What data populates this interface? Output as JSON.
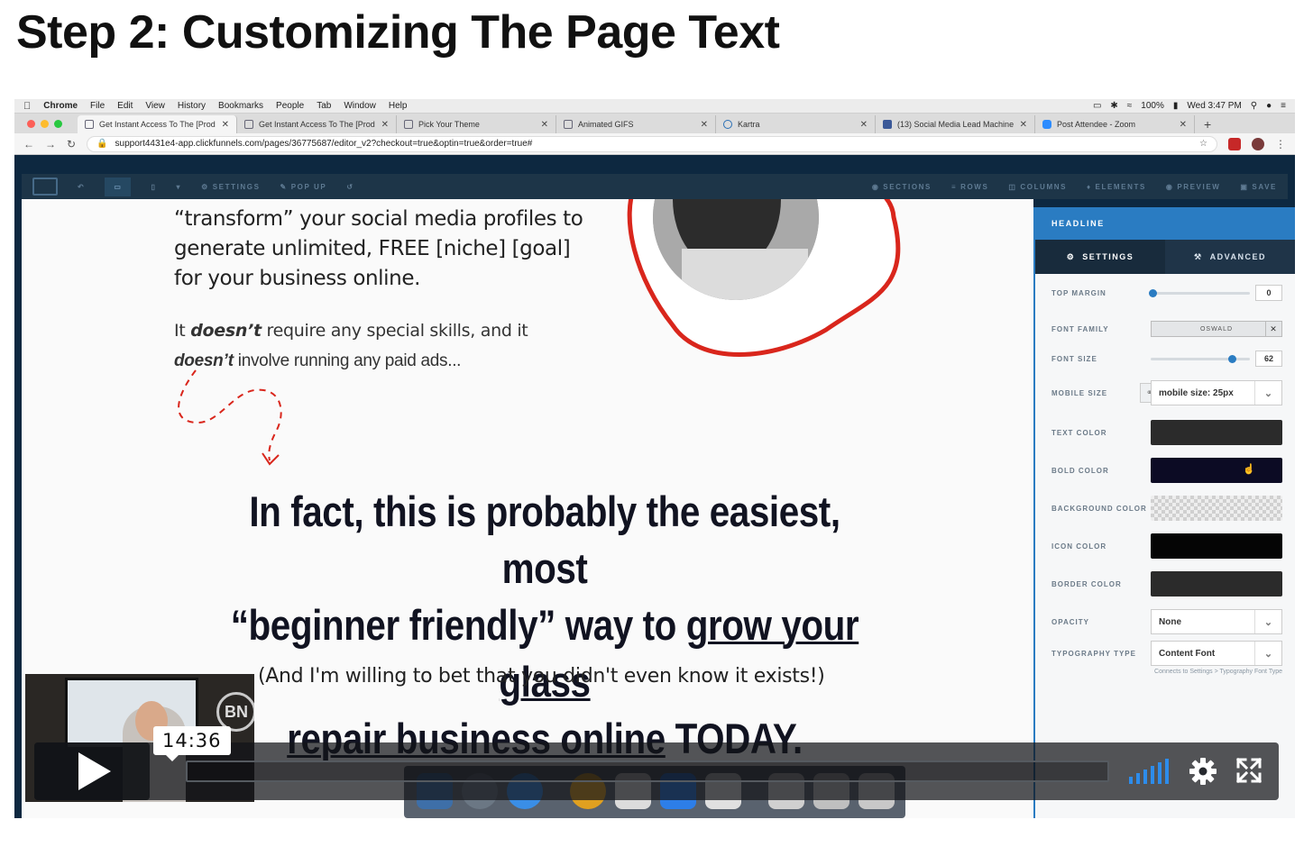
{
  "page": {
    "heading": "Step 2: Customizing The Page Text"
  },
  "mac_menubar": {
    "app": "Chrome",
    "items": [
      "File",
      "Edit",
      "View",
      "History",
      "Bookmarks",
      "People",
      "Tab",
      "Window",
      "Help"
    ],
    "battery": "100%",
    "clock": "Wed 3:47 PM"
  },
  "browser": {
    "tabs": [
      {
        "title": "Get Instant Access To The [Prod"
      },
      {
        "title": "Get Instant Access To The [Prod"
      },
      {
        "title": "Pick Your Theme"
      },
      {
        "title": "Animated GIFS"
      },
      {
        "title": "Kartra"
      },
      {
        "title": "(13) Social Media Lead Machine"
      },
      {
        "title": "Post Attendee - Zoom"
      }
    ],
    "url": "support4431e4-app.clickfunnels.com/pages/36775687/editor_v2?checkout=true&optin=true&order=true#"
  },
  "editor_toolbar": {
    "left": [
      "SETTINGS",
      "POP UP"
    ],
    "right": [
      "SECTIONS",
      "ROWS",
      "COLUMNS",
      "ELEMENTS",
      "PREVIEW",
      "SAVE"
    ]
  },
  "canvas": {
    "para1": [
      "“transform” your social media profiles to",
      "generate unlimited, FREE [niche] [goal]",
      "for your business online."
    ],
    "para2": {
      "a": "It ",
      "b": "doesn’t",
      "c": " require any special skills, and it",
      "d": "doesn’t",
      "e": " involve running any paid ads..."
    },
    "headline": {
      "line1": "In fact, this is probably the easiest, most",
      "line2a": "“beginner friendly” way to ",
      "line2b": "grow your glass",
      "line3a": "repair business online",
      "line3b": " TODAY."
    },
    "subline": "(And I'm willing to bet that you didn't even know it exists!)"
  },
  "panel": {
    "title": "HEADLINE",
    "tab_settings": "SETTINGS",
    "tab_advanced": "ADVANCED",
    "top_margin_label": "TOP MARGIN",
    "top_margin_value": "0",
    "font_family_label": "FONT FAMILY",
    "font_family_value": "OSWALD",
    "font_size_label": "FONT SIZE",
    "font_size_value": "62",
    "mobile_size_label": "MOBILE SIZE",
    "mobile_size_value": "mobile size: 25px",
    "text_color_label": "TEXT COLOR",
    "bold_color_label": "BOLD COLOR",
    "background_color_label": "BACKGROUND COLOR",
    "icon_color_label": "ICON COLOR",
    "border_color_label": "BORDER COLOR",
    "opacity_label": "OPACITY",
    "opacity_value": "None",
    "typography_label": "TYPOGRAPHY TYPE",
    "typography_value": "Content Font",
    "hint": "Connects to Settings > Typography Font Type",
    "colors": {
      "text": "#2b2b2b",
      "bold": "#0c0b24",
      "icon": "#050505",
      "border": "#2b2b2b"
    }
  },
  "player": {
    "time": "14:36",
    "progress_fraction": 0.0,
    "accent": "#2d8ceb",
    "webcam_logo": "BN"
  }
}
